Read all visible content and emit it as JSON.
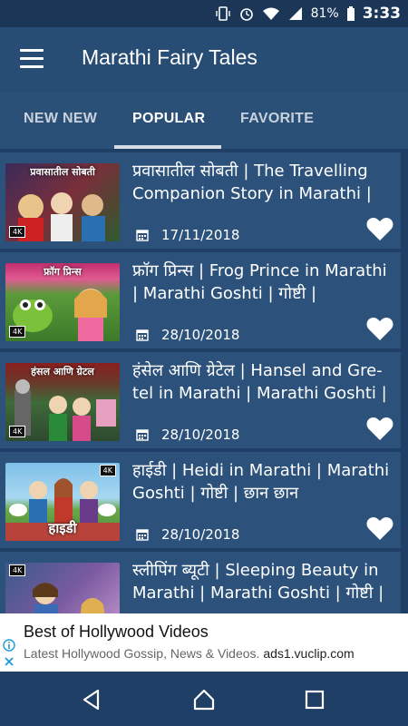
{
  "status_bar": {
    "battery": "81%",
    "time": "3:33"
  },
  "app_bar": {
    "title": "Marathi Fairy Tales"
  },
  "tabs": [
    {
      "label": "NEW NEW",
      "active": false
    },
    {
      "label": "POPULAR",
      "active": true
    },
    {
      "label": "FAVORITE",
      "active": false
    }
  ],
  "stories": [
    {
      "title": "प्रवासातील सोबती | The Travelling Companion Story in Marathi |",
      "date": "17/11/2018",
      "thumb_text": "प्रवासातील सोबती",
      "badge": "4K"
    },
    {
      "title": "फ्रॉग प्रिन्स | Frog Prince in Marathi | Marathi Goshti | गोष्टी |",
      "date": "28/10/2018",
      "thumb_text": "फ्रॉग प्रिन्स",
      "badge": "4K"
    },
    {
      "title": "हंसेल आणि ग्रेटेल | Hansel and Gre-tel in Marathi | Marathi Goshti |",
      "date": "28/10/2018",
      "thumb_text": "हंसल आणि ग्रेटल",
      "badge": "4K"
    },
    {
      "title": "हाईडी | Heidi in Marathi | Marathi Goshti | गोष्टी | छान छान",
      "date": "28/10/2018",
      "thumb_text": "हाइडी",
      "badge": "4K"
    },
    {
      "title": "स्लीपिंग ब्यूटी | Sleeping Beauty in Marathi | Marathi Goshti | गोष्टी |",
      "date": "",
      "thumb_text": "",
      "badge": "4K"
    }
  ],
  "ad": {
    "title": "Best of Hollywood Videos",
    "text": "Latest Hollywood Gossip, News & Videos.",
    "url": "ads1.vuclip.com"
  },
  "colors": {
    "app_bar": "#284d74",
    "tabs": "#2b5078",
    "card": "#2c527c",
    "background": "#1f3f66"
  },
  "icons": [
    "menu-icon",
    "calendar-icon",
    "heart-icon",
    "back-icon",
    "home-icon",
    "recents-icon",
    "ad-info-icon",
    "ad-close-icon"
  ]
}
